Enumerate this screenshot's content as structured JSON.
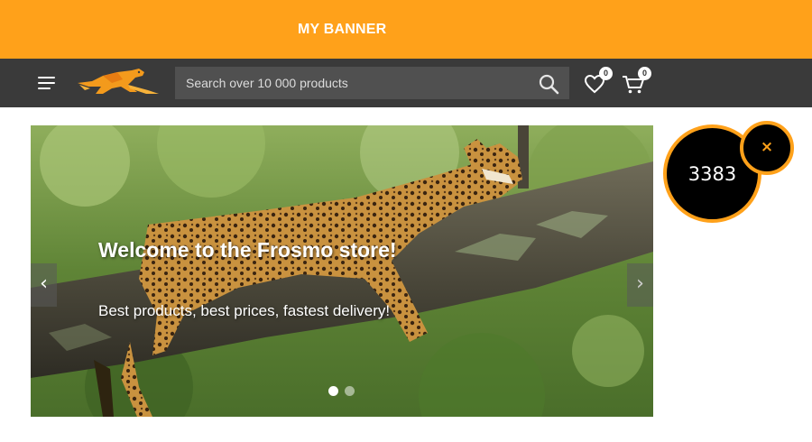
{
  "banner": {
    "text": "MY BANNER",
    "color": "#ffa11a"
  },
  "header": {
    "menu_icon": "hamburger-menu-icon",
    "logo_icon": "leopard-logo-icon",
    "search": {
      "placeholder": "Search over 10 000 products",
      "value": "",
      "icon": "search-icon"
    },
    "wishlist": {
      "icon": "heart-icon",
      "count": "0"
    },
    "cart": {
      "icon": "shopping-cart-icon",
      "count": "0"
    },
    "background": "#3a3a3a"
  },
  "slider": {
    "title": "Welcome to the Frosmo store!",
    "subtitle": "Best products, best prices, fastest delivery!",
    "prev_label": "‹",
    "next_label": "›",
    "slide_count": 2,
    "active_slide": 1
  },
  "counter": {
    "value": "3383",
    "close_label": "×",
    "accent": "#ffa11a"
  }
}
